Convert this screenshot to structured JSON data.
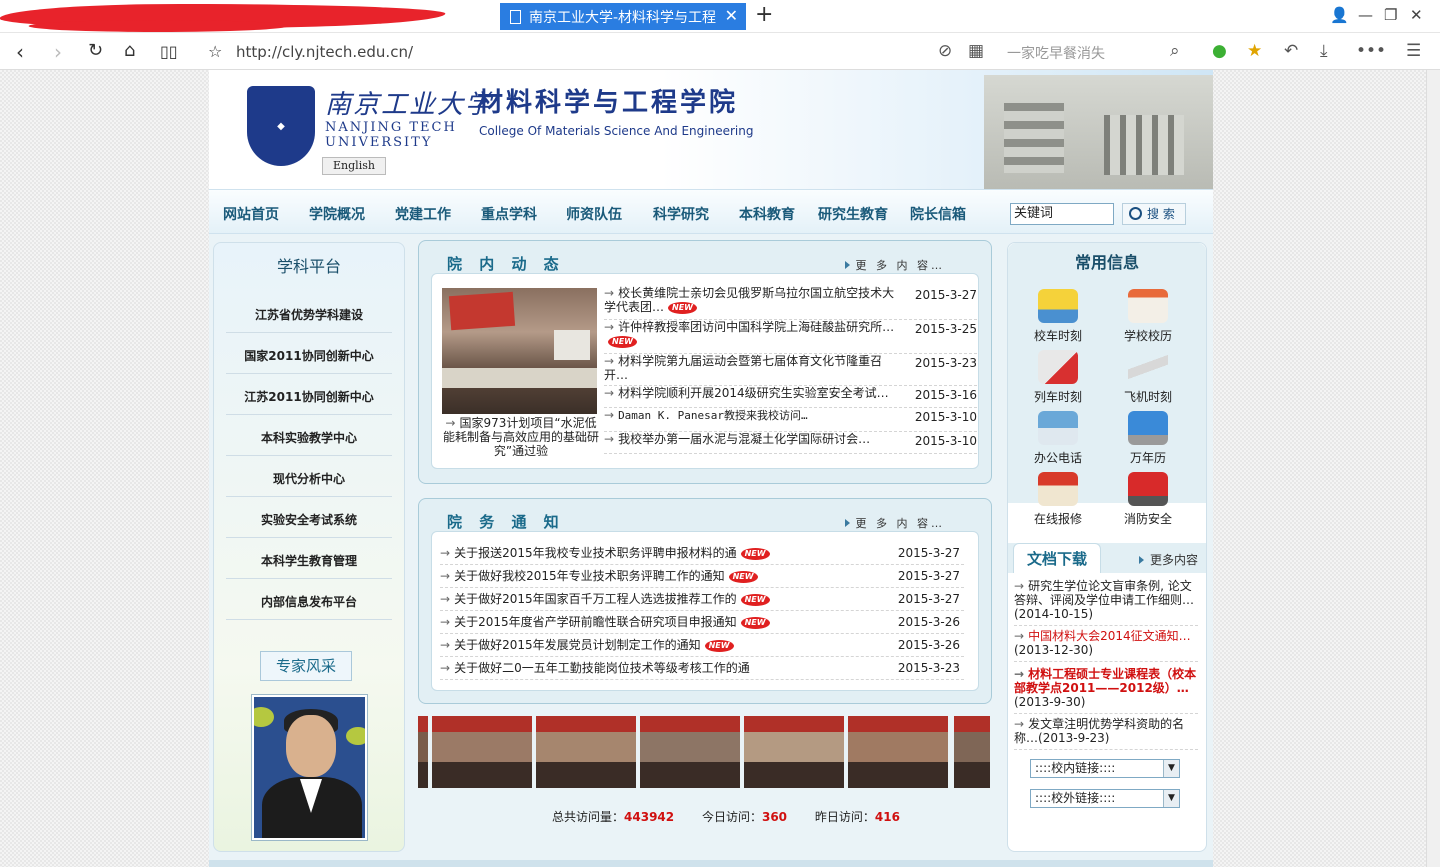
{
  "browser": {
    "tab_title": "南京工业大学-材料科学与工程",
    "url": "http://cly.njtech.edu.cn/",
    "search_placeholder": "一家吃早餐消失"
  },
  "header": {
    "school_cn": "南京工业大学",
    "college_cn": "材料科学与工程学院",
    "school_en_line1": "NANJING TECH",
    "school_en_line2": "UNIVERSITY",
    "college_en": "College Of Materials Science And Engineering",
    "english_btn": "English"
  },
  "nav": {
    "items": [
      "网站首页",
      "学院概况",
      "党建工作",
      "重点学科",
      "师资队伍",
      "科学研究",
      "本科教育",
      "研究生教育",
      "院长信箱"
    ],
    "keyword_value": "关键词",
    "search_label": "搜 索"
  },
  "left": {
    "title": "学科平台",
    "items": [
      "江苏省优势学科建设",
      "国家2011协同创新中心",
      "江苏2011协同创新中心",
      "本科实验教学中心",
      "现代分析中心",
      "实验安全考试系统",
      "本科学生教育管理",
      "内部信息发布平台"
    ],
    "expert_title": "专家风采"
  },
  "news": {
    "title": "院 内 动 态",
    "more": "更 多 内 容…",
    "photo_caption": "国家973计划项目“水泥低能耗制备与高效应用的基础研究”通过验",
    "items": [
      {
        "text": "校长黄维院士亲切会见俄罗斯乌拉尔国立航空技术大学代表团…",
        "date": "2015-3-27",
        "new": true
      },
      {
        "text": "许仲梓教授率团访问中国科学院上海硅酸盐研究所…",
        "date": "2015-3-25",
        "new": true
      },
      {
        "text": "材料学院第九届运动会暨第七届体育文化节隆重召开…",
        "date": "2015-3-23",
        "new": false
      },
      {
        "text": "材料学院顺利开展2014级研究生实验室安全考试…",
        "date": "2015-3-16",
        "new": false
      },
      {
        "text": "Daman K. Panesar教授来我校访问…",
        "date": "2015-3-10",
        "new": false
      },
      {
        "text": "我校举办第一届水泥与混凝土化学国际研讨会…",
        "date": "2015-3-10",
        "new": false
      }
    ]
  },
  "notices": {
    "title": "院 务 通 知",
    "more": "更 多 内 容…",
    "items": [
      {
        "text": "关于报送2015年我校专业技术职务评聘申报材料的通",
        "date": "2015-3-27",
        "new": true
      },
      {
        "text": "关于做好我校2015年专业技术职务评聘工作的通知",
        "date": "2015-3-27",
        "new": true
      },
      {
        "text": "关于做好2015年国家百千万工程人选选拔推荐工作的",
        "date": "2015-3-27",
        "new": true
      },
      {
        "text": "关于2015年度省产学研前瞻性联合研究项目申报通知",
        "date": "2015-3-26",
        "new": true
      },
      {
        "text": "关于做好2015年发展党员计划制定工作的通知",
        "date": "2015-3-26",
        "new": true
      },
      {
        "text": "关于做好二0一五年工勤技能岗位技术等级考核工作的通",
        "date": "2015-3-23",
        "new": false
      }
    ]
  },
  "new_badge": "NEW",
  "stats": {
    "total_label": "总共访问量：",
    "total": "443942",
    "today_label": "今日访问：",
    "today": "360",
    "yesterday_label": "昨日访问：",
    "yesterday": "416"
  },
  "right": {
    "title": "常用信息",
    "items": [
      "校车时刻",
      "学校校历",
      "列车时刻",
      "飞机时刻",
      "办公电话",
      "万年历",
      "在线报修",
      "消防安全"
    ],
    "docs_title": "文档下载",
    "docs_more": "更多内容",
    "docs": [
      {
        "text": "研究生学位论文盲审条例, 论文答辩、评阅及学位申请工作细则…",
        "date": "(2014-10-15)"
      },
      {
        "text": "中国材料大会2014征文通知…",
        "date": "(2013-12-30)"
      },
      {
        "text": "材料工程硕士专业课程表（校本部教学点2011——2012级）…",
        "date": "(2013-9-30)"
      },
      {
        "text": "发文章注明优势学科资助的名称…",
        "date": "(2013-9-23)"
      }
    ],
    "link_inner": "::::校内链接::::",
    "link_outer": "::::校外链接::::"
  }
}
